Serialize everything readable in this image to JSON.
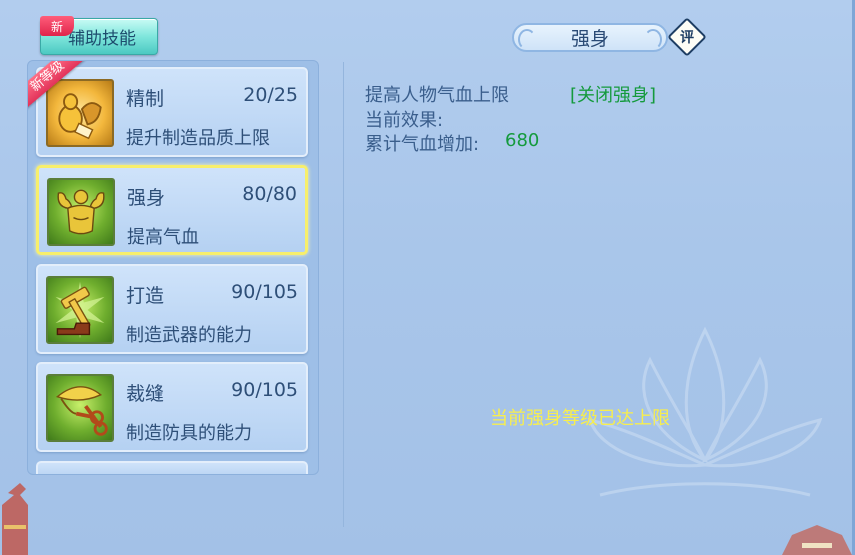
{
  "tab": {
    "label": "辅助技能",
    "new_badge": "新"
  },
  "skills": [
    {
      "name": "精制",
      "level": "20/25",
      "desc": "提升制造品质上限",
      "ribbon": "新等级",
      "icon": "gourd-treasure-icon"
    },
    {
      "name": "强身",
      "level": "80/80",
      "desc": "提高气血",
      "icon": "muscle-man-icon"
    },
    {
      "name": "打造",
      "level": "90/105",
      "desc": "制造武器的能力",
      "icon": "hammer-anvil-icon"
    },
    {
      "name": "裁缝",
      "level": "90/105",
      "desc": "制造防具的能力",
      "icon": "scissors-leaf-icon"
    }
  ],
  "detail": {
    "title": "强身",
    "rate_label": "评",
    "effect_desc": "提高人物气血上限",
    "toggle_link": "[关闭强身]",
    "current_label": "当前效果:",
    "total_label": "累计气血增加:",
    "total_value": "680",
    "max_message": "当前强身等级已达上限"
  },
  "colors": {
    "panel_bg": "#aac8ec",
    "text_blue": "#2e4f78",
    "green": "#149a3c",
    "yellow": "#f7ee4e",
    "selected_border": "#f7ef6c",
    "tab_cyan": "#7fe6dc",
    "ribbon_red": "#e2335a"
  }
}
